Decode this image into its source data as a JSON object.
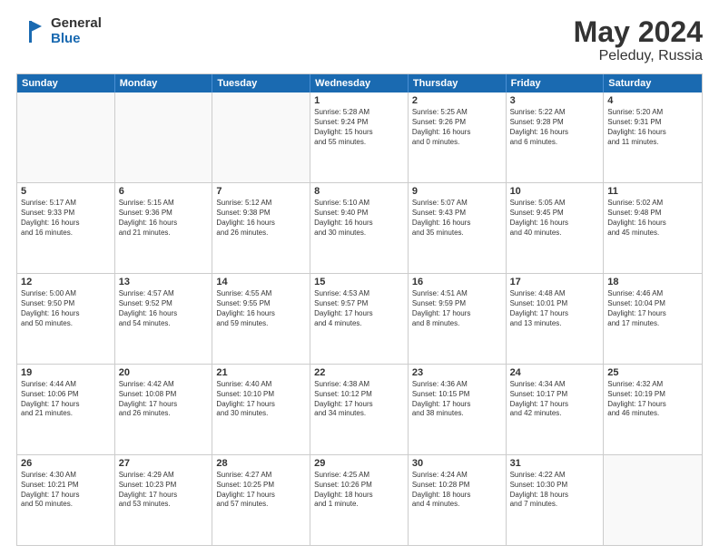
{
  "header": {
    "logo": {
      "general": "General",
      "blue": "Blue"
    },
    "title": "May 2024",
    "location": "Peleduy, Russia"
  },
  "weekdays": [
    "Sunday",
    "Monday",
    "Tuesday",
    "Wednesday",
    "Thursday",
    "Friday",
    "Saturday"
  ],
  "rows": [
    [
      {
        "day": "",
        "empty": true
      },
      {
        "day": "",
        "empty": true
      },
      {
        "day": "",
        "empty": true
      },
      {
        "day": "1",
        "info": "Sunrise: 5:28 AM\nSunset: 9:24 PM\nDaylight: 15 hours\nand 55 minutes."
      },
      {
        "day": "2",
        "info": "Sunrise: 5:25 AM\nSunset: 9:26 PM\nDaylight: 16 hours\nand 0 minutes."
      },
      {
        "day": "3",
        "info": "Sunrise: 5:22 AM\nSunset: 9:28 PM\nDaylight: 16 hours\nand 6 minutes."
      },
      {
        "day": "4",
        "info": "Sunrise: 5:20 AM\nSunset: 9:31 PM\nDaylight: 16 hours\nand 11 minutes."
      }
    ],
    [
      {
        "day": "5",
        "info": "Sunrise: 5:17 AM\nSunset: 9:33 PM\nDaylight: 16 hours\nand 16 minutes."
      },
      {
        "day": "6",
        "info": "Sunrise: 5:15 AM\nSunset: 9:36 PM\nDaylight: 16 hours\nand 21 minutes."
      },
      {
        "day": "7",
        "info": "Sunrise: 5:12 AM\nSunset: 9:38 PM\nDaylight: 16 hours\nand 26 minutes."
      },
      {
        "day": "8",
        "info": "Sunrise: 5:10 AM\nSunset: 9:40 PM\nDaylight: 16 hours\nand 30 minutes."
      },
      {
        "day": "9",
        "info": "Sunrise: 5:07 AM\nSunset: 9:43 PM\nDaylight: 16 hours\nand 35 minutes."
      },
      {
        "day": "10",
        "info": "Sunrise: 5:05 AM\nSunset: 9:45 PM\nDaylight: 16 hours\nand 40 minutes."
      },
      {
        "day": "11",
        "info": "Sunrise: 5:02 AM\nSunset: 9:48 PM\nDaylight: 16 hours\nand 45 minutes."
      }
    ],
    [
      {
        "day": "12",
        "info": "Sunrise: 5:00 AM\nSunset: 9:50 PM\nDaylight: 16 hours\nand 50 minutes."
      },
      {
        "day": "13",
        "info": "Sunrise: 4:57 AM\nSunset: 9:52 PM\nDaylight: 16 hours\nand 54 minutes."
      },
      {
        "day": "14",
        "info": "Sunrise: 4:55 AM\nSunset: 9:55 PM\nDaylight: 16 hours\nand 59 minutes."
      },
      {
        "day": "15",
        "info": "Sunrise: 4:53 AM\nSunset: 9:57 PM\nDaylight: 17 hours\nand 4 minutes."
      },
      {
        "day": "16",
        "info": "Sunrise: 4:51 AM\nSunset: 9:59 PM\nDaylight: 17 hours\nand 8 minutes."
      },
      {
        "day": "17",
        "info": "Sunrise: 4:48 AM\nSunset: 10:01 PM\nDaylight: 17 hours\nand 13 minutes."
      },
      {
        "day": "18",
        "info": "Sunrise: 4:46 AM\nSunset: 10:04 PM\nDaylight: 17 hours\nand 17 minutes."
      }
    ],
    [
      {
        "day": "19",
        "info": "Sunrise: 4:44 AM\nSunset: 10:06 PM\nDaylight: 17 hours\nand 21 minutes."
      },
      {
        "day": "20",
        "info": "Sunrise: 4:42 AM\nSunset: 10:08 PM\nDaylight: 17 hours\nand 26 minutes."
      },
      {
        "day": "21",
        "info": "Sunrise: 4:40 AM\nSunset: 10:10 PM\nDaylight: 17 hours\nand 30 minutes."
      },
      {
        "day": "22",
        "info": "Sunrise: 4:38 AM\nSunset: 10:12 PM\nDaylight: 17 hours\nand 34 minutes."
      },
      {
        "day": "23",
        "info": "Sunrise: 4:36 AM\nSunset: 10:15 PM\nDaylight: 17 hours\nand 38 minutes."
      },
      {
        "day": "24",
        "info": "Sunrise: 4:34 AM\nSunset: 10:17 PM\nDaylight: 17 hours\nand 42 minutes."
      },
      {
        "day": "25",
        "info": "Sunrise: 4:32 AM\nSunset: 10:19 PM\nDaylight: 17 hours\nand 46 minutes."
      }
    ],
    [
      {
        "day": "26",
        "info": "Sunrise: 4:30 AM\nSunset: 10:21 PM\nDaylight: 17 hours\nand 50 minutes."
      },
      {
        "day": "27",
        "info": "Sunrise: 4:29 AM\nSunset: 10:23 PM\nDaylight: 17 hours\nand 53 minutes."
      },
      {
        "day": "28",
        "info": "Sunrise: 4:27 AM\nSunset: 10:25 PM\nDaylight: 17 hours\nand 57 minutes."
      },
      {
        "day": "29",
        "info": "Sunrise: 4:25 AM\nSunset: 10:26 PM\nDaylight: 18 hours\nand 1 minute."
      },
      {
        "day": "30",
        "info": "Sunrise: 4:24 AM\nSunset: 10:28 PM\nDaylight: 18 hours\nand 4 minutes."
      },
      {
        "day": "31",
        "info": "Sunrise: 4:22 AM\nSunset: 10:30 PM\nDaylight: 18 hours\nand 7 minutes."
      },
      {
        "day": "",
        "empty": true
      }
    ]
  ]
}
